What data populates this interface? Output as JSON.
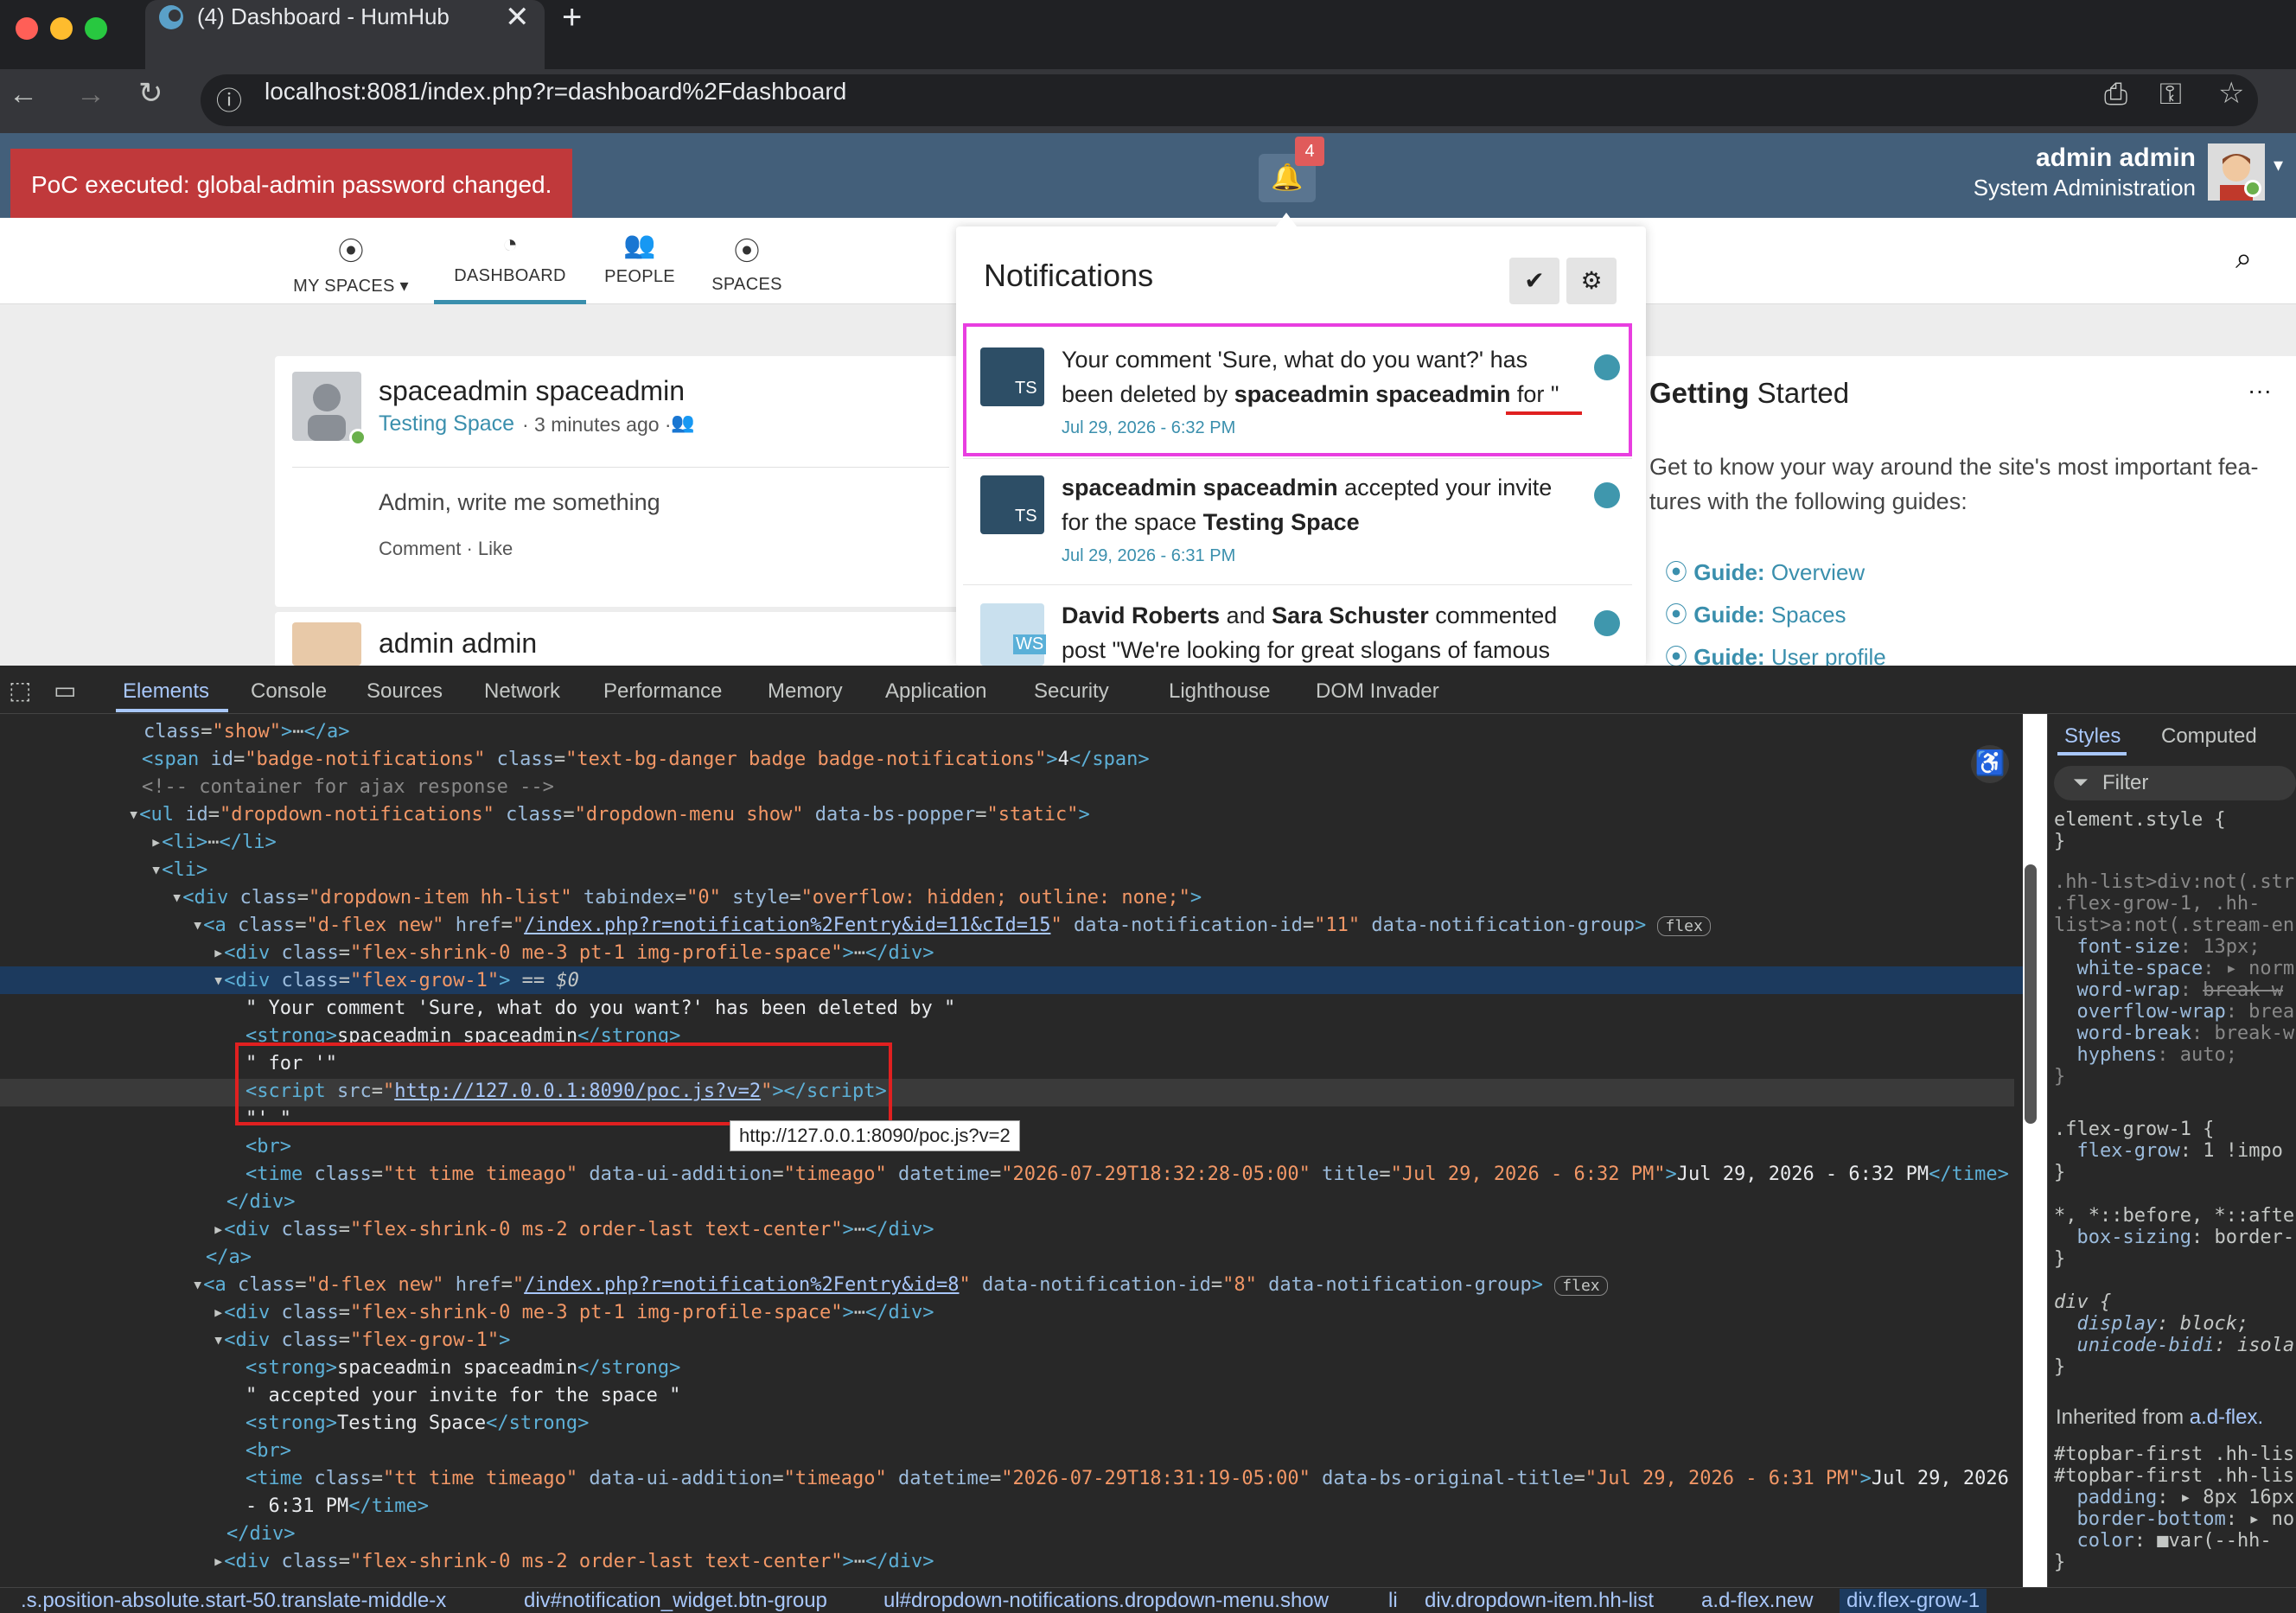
{
  "browser": {
    "tab_title": "(4) Dashboard - HumHub",
    "tab_close": "✕",
    "new_tab": "+",
    "url": "localhost:8081/index.php?r=dashboard%2Fdashboard"
  },
  "alert": {
    "text": "PoC executed: global-admin password changed."
  },
  "topbar": {
    "notification_count": "4",
    "user_name": "admin admin",
    "user_subtitle": "System Administration"
  },
  "nav": {
    "my_spaces": "MY SPACES",
    "dashboard": "DASHBOARD",
    "people": "PEOPLE",
    "spaces": "SPACES"
  },
  "feed": {
    "post1": {
      "author": "spaceadmin spaceadmin",
      "space": "Testing Space",
      "meta": "· 3 minutes ago ·",
      "body": "Admin, write me something",
      "actions": "Comment · Like"
    },
    "post2": {
      "author": "admin admin"
    }
  },
  "getting_started": {
    "title_bold": "Getting",
    "title_rest": "Started",
    "menu": "···",
    "intro": "Get to know your way around the site's most important fea-tures with the following guides:",
    "guides": [
      {
        "label": "Guide:",
        "name": "Overview"
      },
      {
        "label": "Guide:",
        "name": "Spaces"
      },
      {
        "label": "Guide:",
        "name": "User profile"
      }
    ]
  },
  "notifications": {
    "title": "Notifications",
    "items": [
      {
        "badge": "TS",
        "line1": "Your comment 'Sure, what do you want?' has",
        "line2_pre": "been deleted by",
        "line2_bold": "spaceadmin spaceadmin",
        "line2_post": "for \"",
        "time": "Jul 29, 2026 - 6:32 PM"
      },
      {
        "badge": "TS",
        "line1_bold": "spaceadmin spaceadmin",
        "line1_post": "accepted your invite",
        "line2_pre": "for the space",
        "line2_bold": "Testing Space",
        "time": "Jul 29, 2026 - 6:31 PM"
      },
      {
        "badge": "WS",
        "line1_a": "David Roberts",
        "line1_and": "and",
        "line1_b": "Sara Schuster",
        "line1_post": "commented",
        "line2": "post \"We're looking for great slogans of famous"
      }
    ]
  },
  "devtools": {
    "tabs": [
      "Elements",
      "Console",
      "Sources",
      "Network",
      "Performance",
      "Memory",
      "Application",
      "Security",
      "Lighthouse",
      "DOM Invader"
    ],
    "side_tabs": [
      "Styles",
      "Computed"
    ],
    "filter": "Filter",
    "tooltip": "http://127.0.0.1:8090/poc.js?v=2",
    "breadcrumbs": [
      ".s.position-absolute.start-50.translate-middle-x",
      "div#notification_widget.btn-group",
      "ul#dropdown-notifications.dropdown-menu.show",
      "li",
      "div.dropdown-item.hh-list",
      "a.d-flex.new",
      "div.flex-grow-1"
    ]
  }
}
